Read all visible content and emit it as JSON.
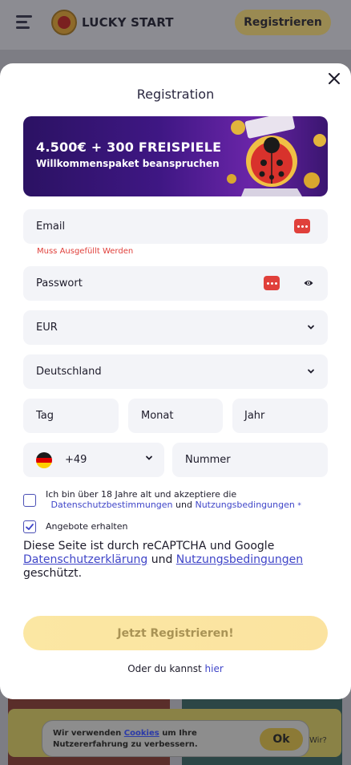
{
  "header": {
    "logo_text": "LUCKY START",
    "register_label": "Registrieren"
  },
  "modal": {
    "title": "Registration",
    "banner": {
      "title": "4.500€ + 300 FREISPIELE",
      "subtitle": "Willkommenspaket beanspruchen"
    },
    "email": {
      "placeholder": "Email",
      "error": "Muss Ausgefüllt Werden"
    },
    "password": {
      "placeholder": "Passwort"
    },
    "currency": {
      "value": "EUR"
    },
    "country": {
      "value": "Deutschland"
    },
    "birthdate": {
      "day": "Tag",
      "month": "Monat",
      "year": "Jahr"
    },
    "phone": {
      "code": "+49",
      "placeholder": "Nummer"
    },
    "terms": {
      "text": "Ich bin über 18 Jahre alt und akzeptiere die",
      "privacy_link": "Datenschutzbestimmungen",
      "and": "und",
      "terms_link": "Nutzungsbedingungen",
      "required_mark": "*",
      "checked": false
    },
    "offers": {
      "text": "Angebote erhalten",
      "checked": true
    },
    "recaptcha": {
      "prefix": "Diese Seite ist durch reCAPTCHA und Google",
      "privacy_link": "Datenschutzerklärung",
      "and": "und",
      "terms_link": "Nutzungsbedingungen",
      "suffix": "geschützt."
    },
    "submit_label": "Jetzt Registrieren!",
    "alt_text": "Oder du kannst",
    "alt_link": "hier"
  },
  "cookie": {
    "text_before": "Wir verwenden",
    "link": "Cookies",
    "text_after": "um Ihre Nutzererfahrung zu verbessern.",
    "ok_label": "Ok",
    "side_text": "Wir?"
  },
  "colors": {
    "accent": "#3f45c8",
    "error": "#e0403b",
    "submit": "#fbe7a3",
    "field_bg": "#f3f4f8"
  },
  "icons": [
    "menu-icon",
    "close-icon",
    "password-manager-icon",
    "eye-icon",
    "chevron-down-icon",
    "germany-flag-icon",
    "checkmark-icon"
  ]
}
